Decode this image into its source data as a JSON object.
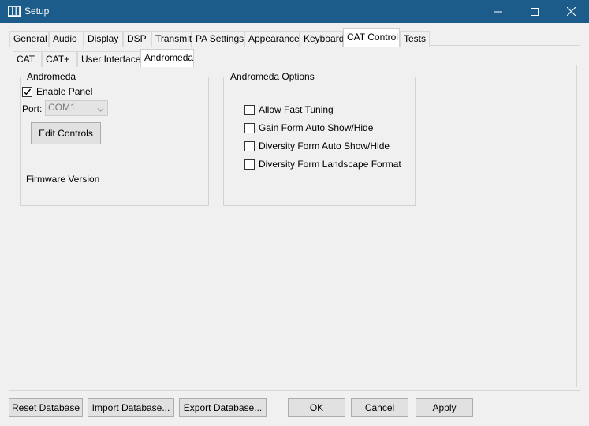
{
  "window": {
    "title": "Setup",
    "app_icon": "setup-app-icon",
    "controls": [
      "minimize-icon",
      "maximize-icon",
      "close-icon"
    ]
  },
  "main_tabs": [
    {
      "label": "General"
    },
    {
      "label": "Audio"
    },
    {
      "label": "Display"
    },
    {
      "label": "DSP"
    },
    {
      "label": "Transmit"
    },
    {
      "label": "PA Settings"
    },
    {
      "label": "Appearance"
    },
    {
      "label": "Keyboard"
    },
    {
      "label": "CAT Control",
      "active": true
    },
    {
      "label": "Tests"
    }
  ],
  "sub_tabs": [
    {
      "label": "CAT"
    },
    {
      "label": "CAT+"
    },
    {
      "label": "User Interface"
    },
    {
      "label": "Andromeda",
      "active": true
    }
  ],
  "andromeda_group": {
    "title": "Andromeda",
    "enable_panel": {
      "label": "Enable Panel",
      "checked": true
    },
    "port_label": "Port:",
    "port_value": "COM1",
    "edit_controls_label": "Edit Controls",
    "firmware_label": "Firmware Version"
  },
  "options_group": {
    "title": "Andromeda Options",
    "options": [
      {
        "label": "Allow Fast Tuning",
        "checked": false
      },
      {
        "label": "Gain Form Auto Show/Hide",
        "checked": false
      },
      {
        "label": "Diversity Form Auto Show/Hide",
        "checked": false
      },
      {
        "label": "Diversity Form Landscape Format",
        "checked": false
      }
    ]
  },
  "footer": {
    "reset_label": "Reset Database",
    "import_label": "Import Database...",
    "export_label": "Export Database...",
    "ok_label": "OK",
    "cancel_label": "Cancel",
    "apply_label": "Apply"
  }
}
